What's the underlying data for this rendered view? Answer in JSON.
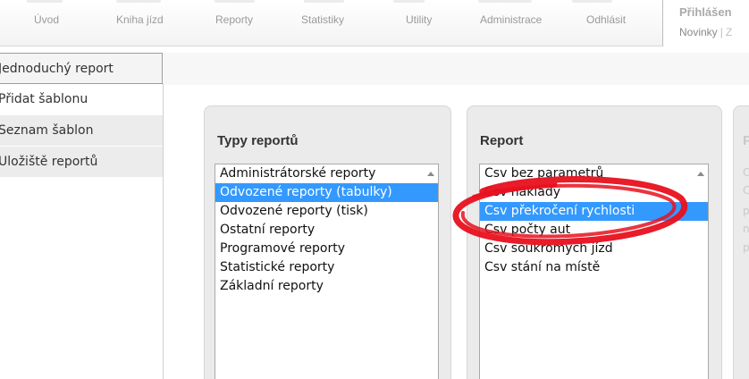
{
  "topnav": {
    "items": [
      "Úvod",
      "Kniha jízd",
      "Reporty",
      "Statistiky",
      "Utility",
      "Administrace",
      "Odhlásit"
    ],
    "login_title": "Přihlášen",
    "link_news": "Novinky",
    "link_separator": "|",
    "link_cut": "Z"
  },
  "sidebar": {
    "items": [
      "Jednoduchý report",
      "Přidat šablonu",
      "Seznam šablon",
      "Uložiště reportů"
    ]
  },
  "panels": {
    "types": {
      "title": "Typy reportů",
      "options": [
        "Administrátorské reporty",
        "Odvozené reporty (tabulky)",
        "Odvozené reporty (tisk)",
        "Ostatní reporty",
        "Programové reporty",
        "Statistické reporty",
        "Základní reporty"
      ],
      "selected_index": 1
    },
    "report": {
      "title": "Report",
      "options": [
        "Csv bez parametrů",
        "Csv náklady",
        "Csv překročení rychlosti",
        "Csv počty aut",
        "Csv soukromých jízd",
        "Csv stání na místě"
      ],
      "selected_index": 2
    },
    "third": {
      "title": "P",
      "lines": [
        "C",
        "C",
        "p",
        "n",
        "p"
      ]
    }
  },
  "colors": {
    "selection": "#3399ff",
    "annotation": "#e8101e"
  },
  "icons": {
    "scroll_up": "scroll-up-arrow-icon"
  }
}
